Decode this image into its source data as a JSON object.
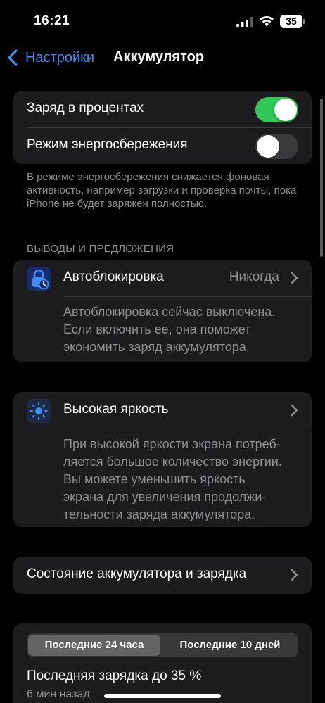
{
  "status_bar": {
    "time": "16:21",
    "battery_percent": "35"
  },
  "nav": {
    "back_label": "Настройки",
    "title": "Аккумулятор"
  },
  "toggles_group": {
    "items": [
      {
        "label": "Заряд в процентах",
        "state": "on"
      },
      {
        "label": "Режим энергосбережения",
        "state": "off"
      }
    ],
    "footnote": "В режиме энергосбережения снижается фоновая активность, например загрузки и проверка почты, пока iPhone не будет заряжен полностью."
  },
  "insights": {
    "section_header": "ВЫВОДЫ И ПРЕДЛОЖЕНИЯ",
    "autolock": {
      "icon": "lock-clock-icon",
      "label": "Автоблокировка",
      "value": "Никогда",
      "description_lines": [
        "Автоблокировка сейчас выключена.",
        "Если включить ее, она поможет",
        "экономить заряд аккумулятора."
      ]
    },
    "brightness": {
      "icon": "sun-icon",
      "label": "Высокая яркость",
      "description_lines": [
        "При высокой яркости экрана потреб-",
        "ляется большое количество энергии.",
        "Вы можете уменьшить яркость",
        "экрана для увеличения продолжи-",
        "тельности заряда аккумулятора."
      ]
    }
  },
  "health": {
    "label": "Состояние аккумулятора и зарядка"
  },
  "usage": {
    "tabs": [
      "Последние 24 часа",
      "Последние 10 дней"
    ],
    "selected_tab": "Последние 24 часа",
    "last_charge": "Последняя зарядка до 35 %",
    "time_ago": "6 мин назад"
  },
  "colors": {
    "accent": "#3d8ff5",
    "toggle_on": "#33c759",
    "group_bg": "#1c1c1e",
    "secondary_text": "#8e8e93"
  }
}
